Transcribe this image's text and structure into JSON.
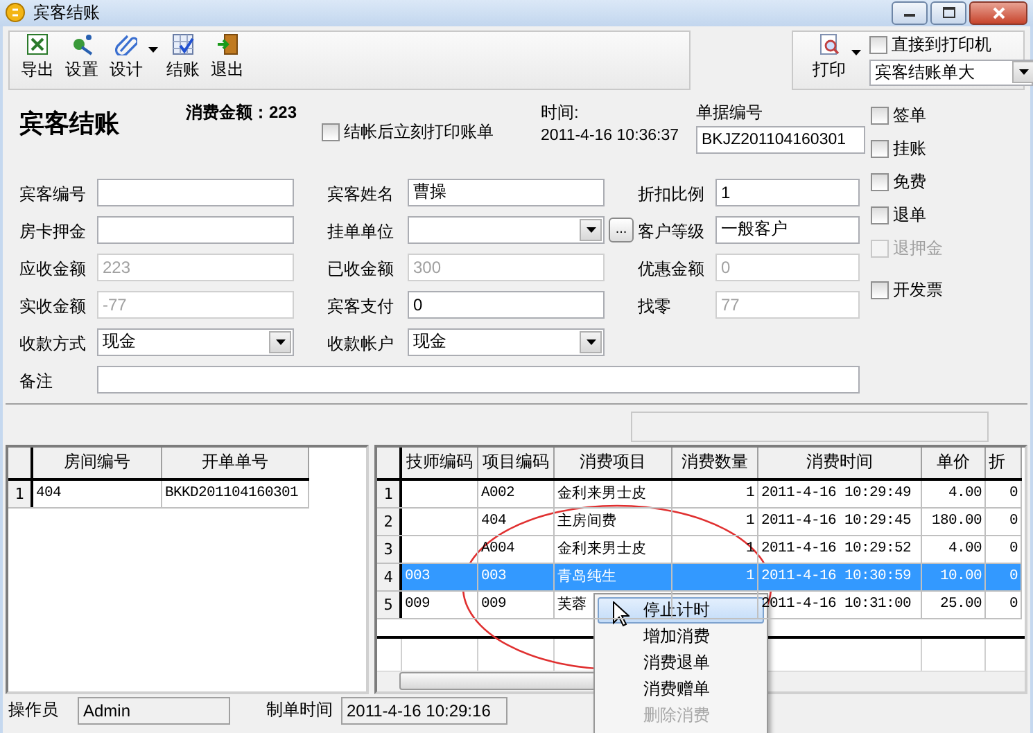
{
  "window": {
    "title": "宾客结账"
  },
  "toolbar": {
    "buttons": [
      {
        "label": "导出",
        "kind": "export",
        "dropdown": false
      },
      {
        "label": "设置",
        "kind": "settings",
        "dropdown": false
      },
      {
        "label": "设计",
        "kind": "design",
        "dropdown": true
      },
      {
        "label": "结账",
        "kind": "checkout",
        "dropdown": false
      },
      {
        "label": "退出",
        "kind": "exit",
        "dropdown": false
      }
    ],
    "print": {
      "label": "打印"
    },
    "direct_print": {
      "label": "直接到打印机",
      "checked": false
    },
    "template": {
      "value": "宾客结账单大"
    }
  },
  "header": {
    "title": "宾客结账",
    "amount": "消费金额：223",
    "print_after": {
      "label": "结帐后立刻打印账单",
      "checked": false
    },
    "time_label": "时间:",
    "time_value": "2011-4-16 10:36:37",
    "bill_no_label": "单据编号",
    "bill_no": "BKJZ201104160301"
  },
  "options": [
    {
      "label": "签单",
      "checked": false,
      "disabled": false
    },
    {
      "label": "挂账",
      "checked": false,
      "disabled": false
    },
    {
      "label": "免费",
      "checked": false,
      "disabled": false
    },
    {
      "label": "退单",
      "checked": false,
      "disabled": false
    },
    {
      "label": "退押金",
      "checked": false,
      "disabled": true
    },
    {
      "label": "开发票",
      "checked": false,
      "disabled": false
    }
  ],
  "form": {
    "rows": [
      [
        {
          "label": "宾客编号",
          "kind": "text",
          "disabled": false
        },
        {
          "label": "宾客姓名",
          "kind": "text",
          "value": "曹操",
          "disabled": false
        },
        {
          "label": "折扣比例",
          "kind": "text",
          "value": "1",
          "disabled": false
        }
      ],
      [
        {
          "label": "房卡押金",
          "kind": "text",
          "disabled": false
        },
        {
          "label": "挂单单位",
          "kind": "combo",
          "browse": "...",
          "disabled": false
        },
        {
          "label": "客户等级",
          "kind": "text",
          "value": "一般客户",
          "disabled": false
        }
      ],
      [
        {
          "label": "应收金额",
          "kind": "text",
          "value": "223",
          "disabled": true
        },
        {
          "label": "已收金额",
          "kind": "text",
          "value": "300",
          "disabled": true
        },
        {
          "label": "优惠金额",
          "kind": "text",
          "value": "0",
          "disabled": true
        }
      ],
      [
        {
          "label": "实收金额",
          "kind": "text",
          "value": "-77",
          "disabled": true
        },
        {
          "label": "宾客支付",
          "kind": "text",
          "value": "0",
          "disabled": false
        },
        {
          "label": "找零",
          "kind": "text",
          "value": "77",
          "disabled": true
        }
      ],
      [
        {
          "label": "收款方式",
          "kind": "combo",
          "value": "现金",
          "disabled": false
        },
        {
          "label": "收款帐户",
          "kind": "combo",
          "value": "现金",
          "disabled": false
        }
      ]
    ],
    "remark": {
      "label": "备注"
    }
  },
  "rooms": {
    "columns": [
      "房间编号",
      "开单单号"
    ],
    "rows": [
      {
        "index": "1",
        "cells": [
          "404",
          "BKKD201104160301"
        ],
        "selected": false
      }
    ]
  },
  "items": {
    "columns": [
      "技师编码",
      "项目编码",
      "消费项目",
      "消费数量",
      "消费时间",
      "单价",
      "折"
    ],
    "rows": [
      {
        "index": "1",
        "cells": [
          "",
          "A002",
          "金利来男士皮",
          "1",
          "2011-4-16 10:29:49",
          "4.00",
          "0"
        ],
        "selected": false
      },
      {
        "index": "2",
        "cells": [
          "",
          "404",
          "主房间费",
          "1",
          "2011-4-16 10:29:45",
          "180.00",
          "0"
        ],
        "selected": false
      },
      {
        "index": "3",
        "cells": [
          "",
          "A004",
          "金利来男士皮",
          "1",
          "2011-4-16 10:29:52",
          "4.00",
          "0"
        ],
        "selected": false
      },
      {
        "index": "4",
        "cells": [
          "003",
          "003",
          "青岛纯生",
          "1",
          "2011-4-16 10:30:59",
          "10.00",
          "0"
        ],
        "selected": true
      },
      {
        "index": "5",
        "cells": [
          "009",
          "009",
          "芙蓉",
          null,
          "2011-4-16 10:31:00",
          "25.00",
          "0"
        ],
        "selected": false
      }
    ]
  },
  "context_menu": {
    "items": [
      {
        "label": "停止计时",
        "selected": true,
        "disabled": false
      },
      {
        "label": "增加消费",
        "selected": false,
        "disabled": false
      },
      {
        "label": "消费退单",
        "selected": false,
        "disabled": false
      },
      {
        "label": "消费赠单",
        "selected": false,
        "disabled": false
      },
      {
        "label": "删除消费",
        "selected": false,
        "disabled": true
      }
    ]
  },
  "status_bar": {
    "operator_label": "操作员",
    "operator": "Admin",
    "created_label": "制单时间",
    "created": "2011-4-16 10:29:16"
  }
}
